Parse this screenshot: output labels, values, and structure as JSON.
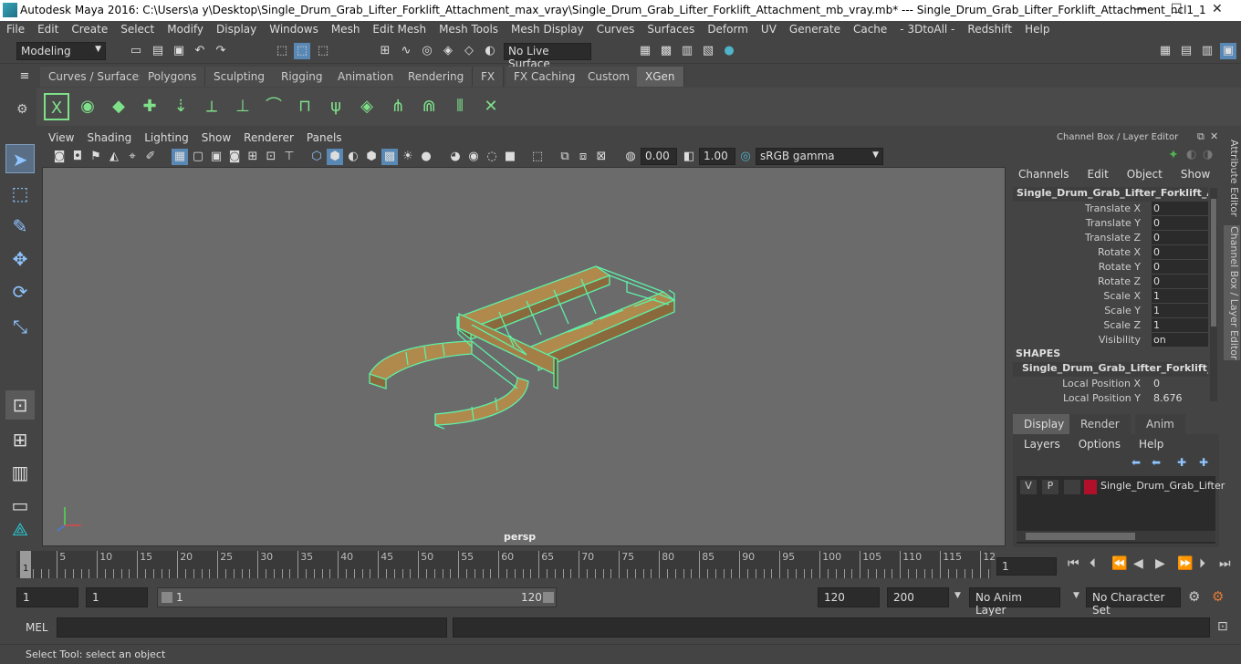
{
  "window": {
    "title": "Autodesk Maya 2016: C:\\Users\\a y\\Desktop\\Single_Drum_Grab_Lifter_Forklift_Attachment_max_vray\\Single_Drum_Grab_Lifter_Forklift_Attachment_mb_vray.mb*   ---   Single_Drum_Grab_Lifter_Forklift_Attachment_ncl1_1",
    "minimize": "—",
    "maximize": "☐",
    "close": "✕"
  },
  "menubar": [
    "File",
    "Edit",
    "Create",
    "Select",
    "Modify",
    "Display",
    "Windows",
    "Mesh",
    "Edit Mesh",
    "Mesh Tools",
    "Mesh Display",
    "Curves",
    "Surfaces",
    "Deform",
    "UV",
    "Generate",
    "Cache",
    "- 3DtoAll -",
    "Redshift",
    "Help"
  ],
  "statusline": {
    "mode": "Modeling",
    "live_surface": "No Live Surface"
  },
  "shelf_tabs": [
    "Curves / Surfaces",
    "Polygons",
    "Sculpting",
    "Rigging",
    "Animation",
    "Rendering",
    "FX",
    "FX Caching",
    "Custom",
    "XGen"
  ],
  "shelf_active": "XGen",
  "viewport": {
    "menu": [
      "View",
      "Shading",
      "Lighting",
      "Show",
      "Renderer",
      "Panels"
    ],
    "exposure": "0.00",
    "gamma": "1.00",
    "color_space": "sRGB gamma",
    "camera_label": "persp"
  },
  "channel_box": {
    "title": "Channel Box / Layer Editor",
    "menu": [
      "Channels",
      "Edit",
      "Object",
      "Show"
    ],
    "object_name": "Single_Drum_Grab_Lifter_Forklift_Atta...",
    "channels": [
      {
        "label": "Translate X",
        "value": "0"
      },
      {
        "label": "Translate Y",
        "value": "0"
      },
      {
        "label": "Translate Z",
        "value": "0"
      },
      {
        "label": "Rotate X",
        "value": "0"
      },
      {
        "label": "Rotate Y",
        "value": "0"
      },
      {
        "label": "Rotate Z",
        "value": "0"
      },
      {
        "label": "Scale X",
        "value": "1"
      },
      {
        "label": "Scale Y",
        "value": "1"
      },
      {
        "label": "Scale Z",
        "value": "1"
      },
      {
        "label": "Visibility",
        "value": "on"
      }
    ],
    "shapes_label": "SHAPES",
    "shape_name": "Single_Drum_Grab_Lifter_Forklift_At...",
    "shape_channels": [
      {
        "label": "Local Position X",
        "value": "0"
      },
      {
        "label": "Local Position Y",
        "value": "8.676"
      }
    ]
  },
  "side_tabs": [
    "Attribute Editor",
    "Channel Box / Layer Editor"
  ],
  "layer_editor": {
    "tabs": [
      "Display",
      "Render",
      "Anim"
    ],
    "active_tab": "Display",
    "menu": [
      "Layers",
      "Options",
      "Help"
    ],
    "layer": {
      "v": "V",
      "p": "P",
      "name": "Single_Drum_Grab_Lifter",
      "color": "#b0102a"
    }
  },
  "timeline": {
    "ticks": [
      "5",
      "10",
      "15",
      "20",
      "25",
      "30",
      "35",
      "40",
      "45",
      "50",
      "55",
      "60",
      "65",
      "70",
      "75",
      "80",
      "85",
      "90",
      "95",
      "100",
      "105",
      "110",
      "115",
      "12"
    ],
    "current_frame_marker": "1",
    "current_frame": "1"
  },
  "range": {
    "start": "1",
    "anim_start": "1",
    "slider_start": "1",
    "slider_end": "120",
    "end": "120",
    "anim_end": "200",
    "anim_layer": "No Anim Layer",
    "character_set": "No Character Set"
  },
  "command_line": {
    "label": "MEL"
  },
  "help_line": "Select Tool: select an object"
}
